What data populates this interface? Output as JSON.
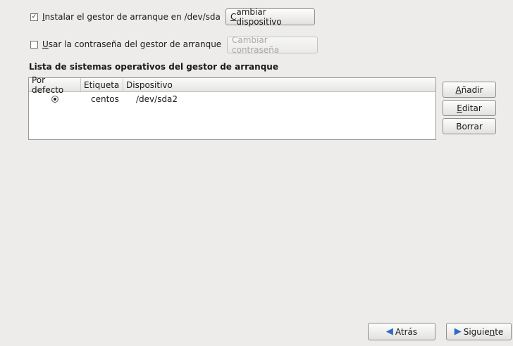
{
  "options": {
    "install_label_prefix": "",
    "install_mnemonic": "I",
    "install_label_rest": "nstalar el gestor de arranque en /dev/sda",
    "install_checked": true,
    "change_device_mnemonic": "C",
    "change_device_rest": "ambiar dispositivo",
    "password_mnemonic": "U",
    "password_label_rest": "sar la contraseña del gestor de arranque",
    "password_checked": false,
    "change_password_label": "Cambiar contraseña"
  },
  "list": {
    "title": "Lista de sistemas operativos del gestor de arranque",
    "columns": [
      "Por defecto",
      "Etiqueta",
      "Dispositivo"
    ],
    "rows": [
      {
        "default": true,
        "label": "centos",
        "device": "/dev/sda2"
      }
    ]
  },
  "side_buttons": {
    "add_mnemonic": "A",
    "add_rest": "ñadir",
    "edit_mnemonic": "E",
    "edit_rest": "ditar",
    "delete_label": "Borrar"
  },
  "nav": {
    "back_label": "Atrás",
    "next_prefix": "Siguie",
    "next_mnemonic": "n",
    "next_rest": "te"
  }
}
